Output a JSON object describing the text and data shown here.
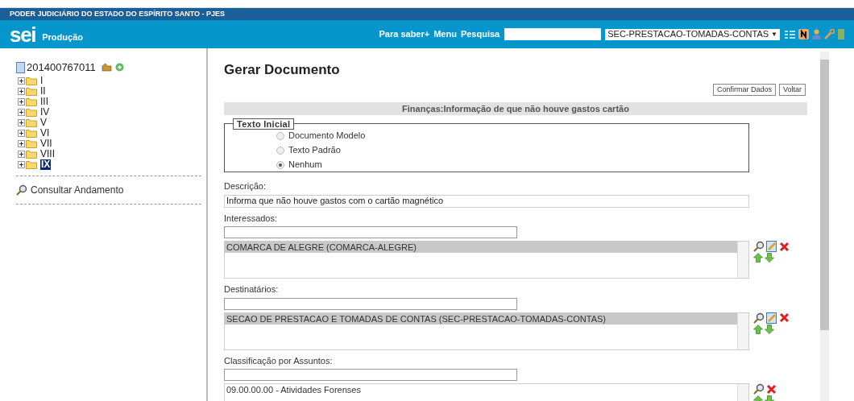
{
  "header": {
    "organization": "PODER JUDICIÁRIO DO ESTADO DO ESPÍRITO SANTO - PJES",
    "logo": "sei",
    "environment": "Produção",
    "links": [
      "Para saber+",
      "Menu",
      "Pesquisa"
    ],
    "unit": "SEC-PRESTACAO-TOMADAS-CONTAS",
    "unit_caret": "▼"
  },
  "sidebar": {
    "process": "201400767011",
    "folders": [
      {
        "label": "I",
        "selected": false
      },
      {
        "label": "II",
        "selected": false
      },
      {
        "label": "III",
        "selected": false
      },
      {
        "label": "IV",
        "selected": false
      },
      {
        "label": "V",
        "selected": false
      },
      {
        "label": "VI",
        "selected": false
      },
      {
        "label": "VII",
        "selected": false
      },
      {
        "label": "VIII",
        "selected": false
      },
      {
        "label": "IX",
        "selected": true
      }
    ],
    "link": "Consultar Andamento"
  },
  "main": {
    "title": "Gerar Documento",
    "buttons": [
      "Confirmar Dados",
      "Voltar"
    ],
    "doc_type": "Finanças:Informação de que não houve gastos cartão",
    "initial_text": {
      "legend": "Texto Inicial",
      "options": [
        {
          "label": "Documento Modelo",
          "selected": false
        },
        {
          "label": "Texto Padrão",
          "selected": false
        },
        {
          "label": "Nenhum",
          "selected": true
        }
      ]
    },
    "description": {
      "label": "Descrição:",
      "value": "Informa que não houve gastos com o cartão magnético"
    },
    "lists": [
      {
        "label": "Interessados:",
        "editable": true,
        "items": [
          {
            "text": "COMARCA DE ALEGRE (COMARCA-ALEGRE)",
            "selected": true
          }
        ]
      },
      {
        "label": "Destinatários:",
        "editable": true,
        "items": [
          {
            "text": "SECAO DE PRESTACAO E TOMADAS DE CONTAS (SEC-PRESTACAO-TOMADAS-CONTAS)",
            "selected": true
          }
        ]
      },
      {
        "label": "Classificação por Assuntos:",
        "editable": false,
        "items": [
          {
            "text": "09.00.00.00 - Atividades Forenses",
            "selected": false
          }
        ]
      }
    ]
  }
}
